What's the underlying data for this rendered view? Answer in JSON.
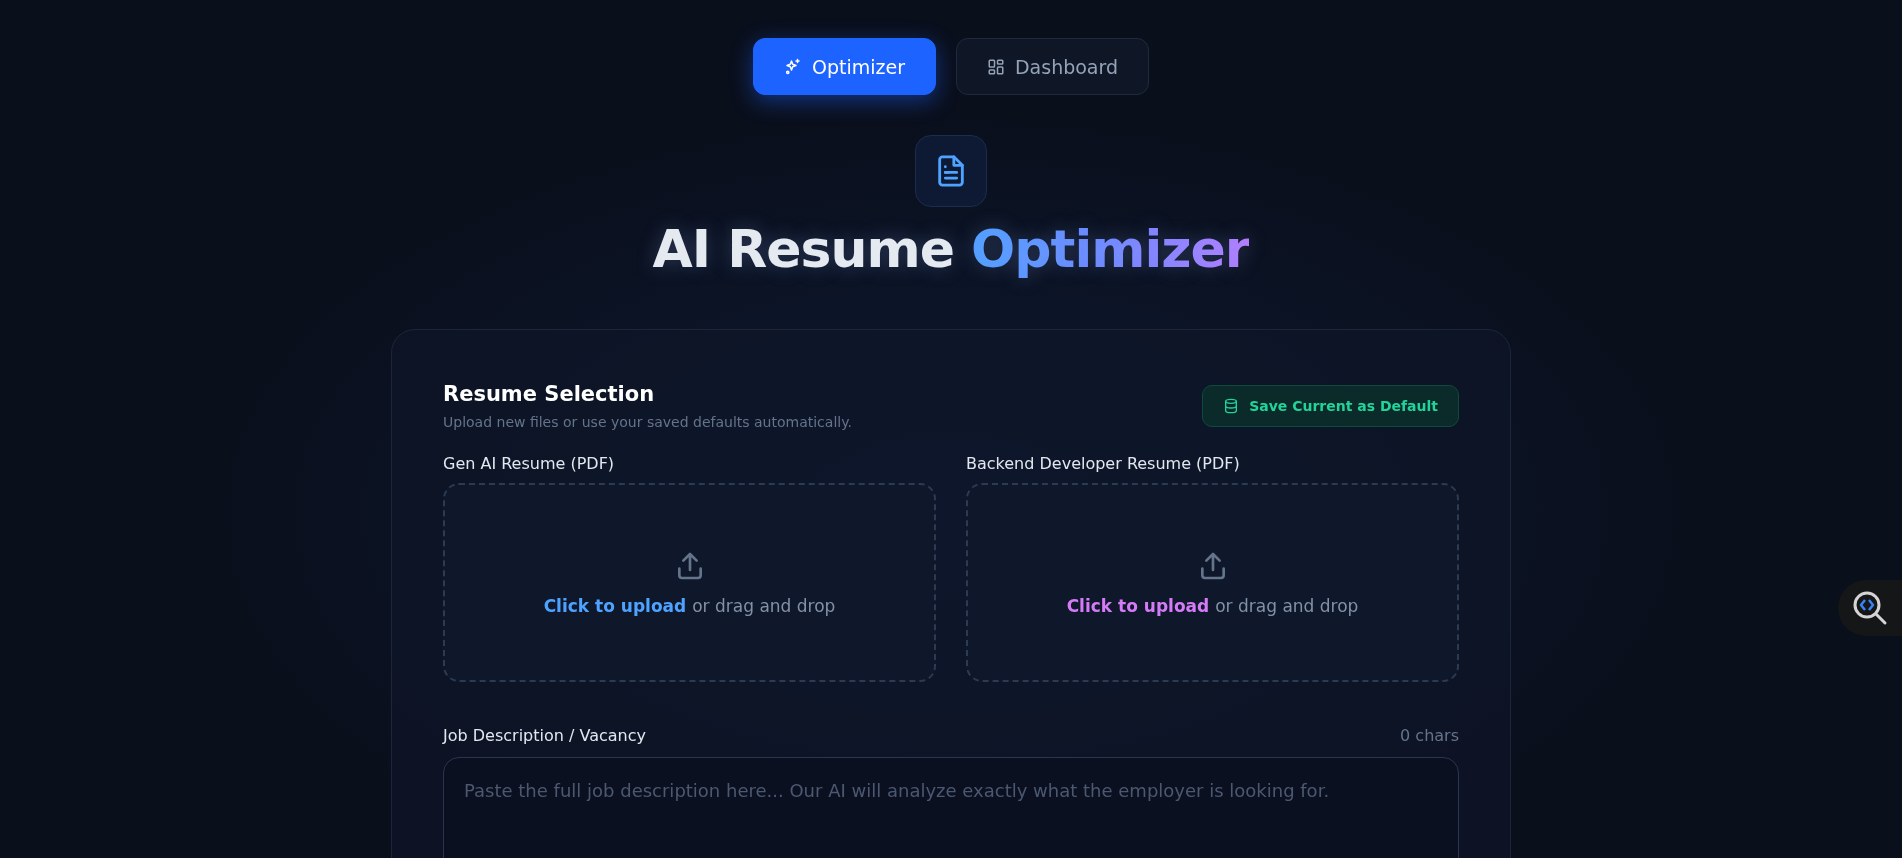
{
  "tabs": [
    {
      "label": "Optimizer",
      "kind": "sparkles",
      "selected": true
    },
    {
      "label": "Dashboard",
      "kind": "grid",
      "selected": false
    }
  ],
  "header": {
    "title": "AI Resume",
    "title_accent": "Optimizer"
  },
  "resume_section": {
    "title": "Resume Selection",
    "subtitle": "Upload new files or use your saved defaults automatically.",
    "save_button": "Save Current as Default",
    "uploads": [
      {
        "label": "Gen AI Resume (PDF)",
        "link": "Click to upload",
        "rest": "or drag and drop",
        "color": "#4da3ff"
      },
      {
        "label": "Backend Developer Resume (PDF)",
        "link": "Click to upload",
        "rest": "or drag and drop",
        "color": "#d57bf7"
      }
    ]
  },
  "job_description": {
    "label": "Job Description / Vacancy",
    "count": "0 chars",
    "placeholder": "Paste the full job description here... Our AI will analyze exactly what the employer is looking for."
  }
}
